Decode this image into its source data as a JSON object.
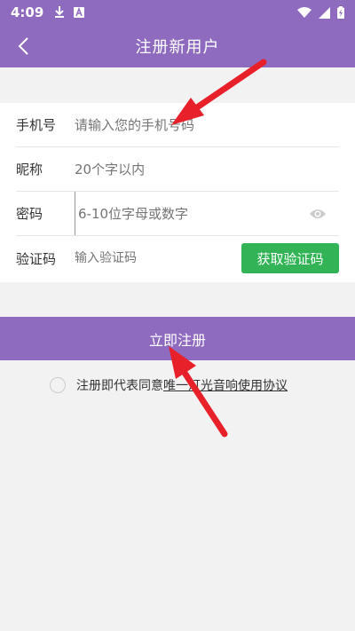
{
  "status_bar": {
    "time": "4:09"
  },
  "header": {
    "title": "注册新用户"
  },
  "form": {
    "phone": {
      "label": "手机号",
      "placeholder": "请输入您的手机号码"
    },
    "nickname": {
      "label": "昵称",
      "placeholder": "20个字以内"
    },
    "password": {
      "label": "密码",
      "placeholder": "6-10位字母或数字"
    },
    "code": {
      "label": "验证码",
      "placeholder": "输入验证码",
      "button": "获取验证码"
    }
  },
  "register": {
    "label": "立即注册"
  },
  "agreement": {
    "prefix": "注册即代表同意",
    "link": "唯一灯光音响使用协议"
  },
  "colors": {
    "accent": "#8e6bbf",
    "green": "#32b456",
    "arrow": "#e8202a"
  }
}
